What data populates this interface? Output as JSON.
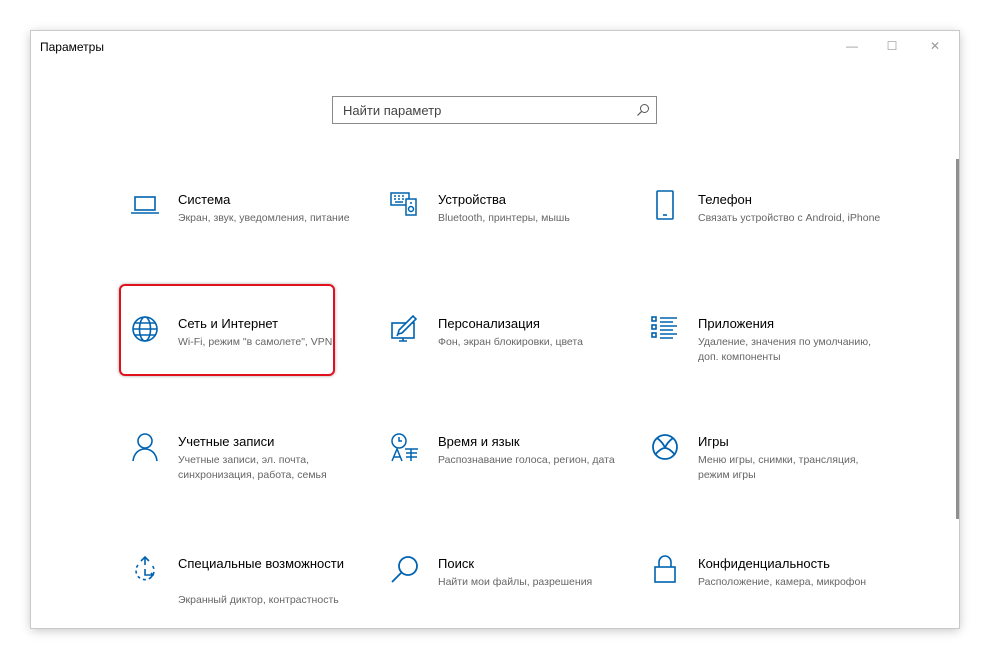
{
  "window": {
    "title": "Параметры",
    "controls": {
      "minimize": "—",
      "maximize": "☐",
      "close": "✕"
    }
  },
  "search": {
    "placeholder": "Найти параметр"
  },
  "accent_color": "#0063b1",
  "highlight_color": "#e0101d",
  "tiles": [
    {
      "name": "Система",
      "desc": "Экран, звук, уведомления, питание",
      "icon": "laptop-icon"
    },
    {
      "name": "Устройства",
      "desc": "Bluetooth, принтеры, мышь",
      "icon": "devices-icon"
    },
    {
      "name": "Телефон",
      "desc": "Связать устройство с Android, iPhone",
      "icon": "phone-icon"
    },
    {
      "name": "Сеть и Интернет",
      "desc": "Wi-Fi, режим \"в самолете\", VPN",
      "icon": "globe-icon"
    },
    {
      "name": "Персонализация",
      "desc": "Фон, экран блокировки, цвета",
      "icon": "personalization-icon"
    },
    {
      "name": "Приложения",
      "desc": "Удаление, значения по умолчанию, доп. компоненты",
      "icon": "apps-list-icon"
    },
    {
      "name": "Учетные записи",
      "desc": "Учетные записи, эл. почта, синхронизация, работа, семья",
      "icon": "person-icon"
    },
    {
      "name": "Время и язык",
      "desc": "Распознавание голоса, регион, дата",
      "icon": "time-language-icon"
    },
    {
      "name": "Игры",
      "desc": "Меню игры, снимки, трансляция, режим игры",
      "icon": "xbox-icon"
    },
    {
      "name": "Специальные возможности",
      "desc": "Экранный диктор, контрастность",
      "icon": "accessibility-icon"
    },
    {
      "name": "Поиск",
      "desc": "Найти мои файлы, разрешения",
      "icon": "search-icon"
    },
    {
      "name": "Конфиденциальность",
      "desc": "Расположение, камера, микрофон",
      "icon": "lock-icon"
    }
  ]
}
